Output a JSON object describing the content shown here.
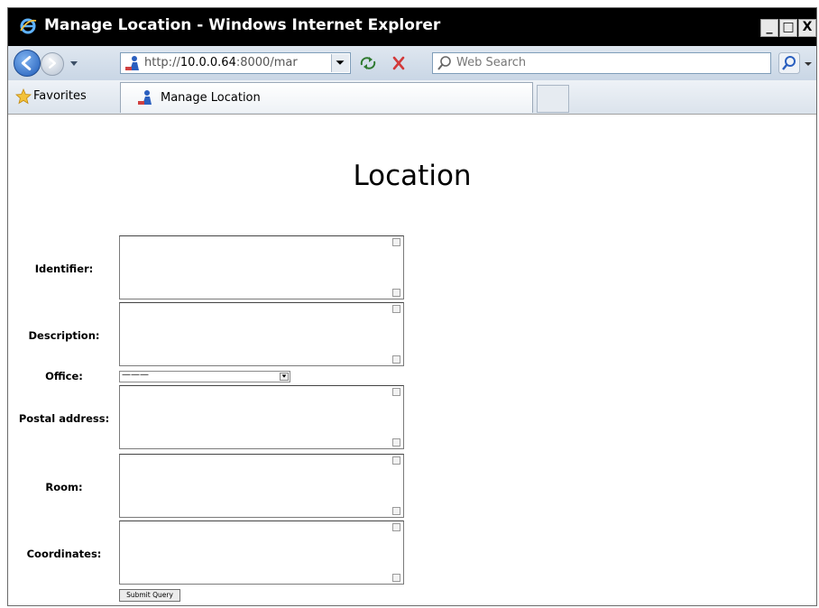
{
  "window": {
    "title": "Manage Location - Windows Internet Explorer",
    "buttons": {
      "minimize": "_",
      "maximize": "□",
      "close": "X"
    }
  },
  "addressbar": {
    "url_prefix": "http://",
    "url_host": "10.0.0.64",
    "url_rest": ":8000/mar",
    "search_placeholder": "Web Search"
  },
  "favorites": {
    "label": "Favorites",
    "tab_label": "Manage Location"
  },
  "page": {
    "title": "Location",
    "fields": [
      {
        "label": "Identifier:"
      },
      {
        "label": "Description:"
      },
      {
        "label": "Office:",
        "value": "———"
      },
      {
        "label": "Postal address:"
      },
      {
        "label": "Room:"
      },
      {
        "label": "Coordinates:"
      }
    ],
    "submit_label": "Submit Query"
  },
  "colors": {
    "titlebar_bg": "#000000",
    "toolbar_bg": "#dfe7f0",
    "accent_blue": "#1f5bb8"
  },
  "icons": {
    "titlebar": "ie-logo-icon",
    "back": "back-arrow-icon",
    "forward": "forward-arrow-icon",
    "url": "page-person-icon",
    "refresh": "refresh-icon",
    "stop": "stop-icon",
    "search": "search-icon",
    "favorites": "favorites-star-icon"
  }
}
